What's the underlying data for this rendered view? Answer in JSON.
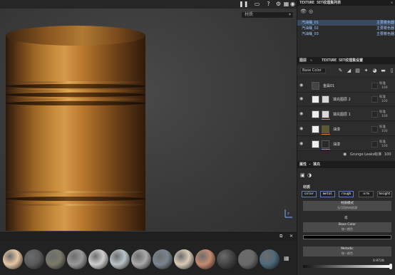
{
  "viewport": {
    "material_select": "材质",
    "toolbar_icons": [
      "pause-icon",
      "video-icon",
      "help-icon",
      "settings-icon",
      "grid-icon",
      "camera-icon"
    ]
  },
  "texture_set_list": {
    "title": "TEXTURE SET纹理集列表",
    "items": [
      {
        "name": "汽油桶_01",
        "status": "主要着色器",
        "selected": true
      },
      {
        "name": "汽油桶_02",
        "status": "主要着色器",
        "selected": false
      },
      {
        "name": "汽油桶_03",
        "status": "主要着色器",
        "selected": false
      }
    ]
  },
  "tabs": {
    "layers": "图层",
    "texture_set_settings": "TEXTURE SET纹理集设置"
  },
  "layer_toolbar": {
    "channel": "Base Color"
  },
  "layers": [
    {
      "name": "金属01",
      "blend": "标准",
      "opacity": "100",
      "thumb": "#6a3a1c"
    },
    {
      "name": "填充图层 2",
      "blend": "标准",
      "opacity": "100",
      "thumb": "#d8d8d8"
    },
    {
      "name": "填充图层 1",
      "blend": "标准",
      "opacity": "100",
      "thumb": "#d8d8d8"
    },
    {
      "name": "油漆",
      "blend": "标准",
      "opacity": "100",
      "thumb": "#5a5a2a"
    },
    {
      "name": "油漆",
      "blend": "标准",
      "opacity": "100",
      "thumb": "#2a2a2a"
    }
  ],
  "grunge": {
    "name": "Grunge Leaks",
    "blend": "标准",
    "opacity": "100"
  },
  "properties": {
    "title": "属性 - 填充",
    "section": "材质",
    "channels": [
      "color",
      "metal",
      "rough",
      "nrm",
      "height"
    ],
    "material_mode": {
      "label": "材质模式",
      "sub": "无可用的材质源"
    },
    "or": "或",
    "base_color": {
      "label": "Base Color",
      "sub": "统一颜色"
    },
    "metallic": {
      "label": "Metallic",
      "sub": "统一颜色",
      "value": "0.9728"
    }
  },
  "shelf": {
    "balls": [
      "#e7c7a5",
      "#5a5a5a",
      "#7a7a6a",
      "#9a9a9a",
      "#cfcfcf",
      "#b8c4c8",
      "#aaaaaa",
      "#7b8690",
      "#d8cbb8",
      "#c48a70",
      "#444444",
      "#6a6a6a",
      "#506a7a"
    ]
  }
}
